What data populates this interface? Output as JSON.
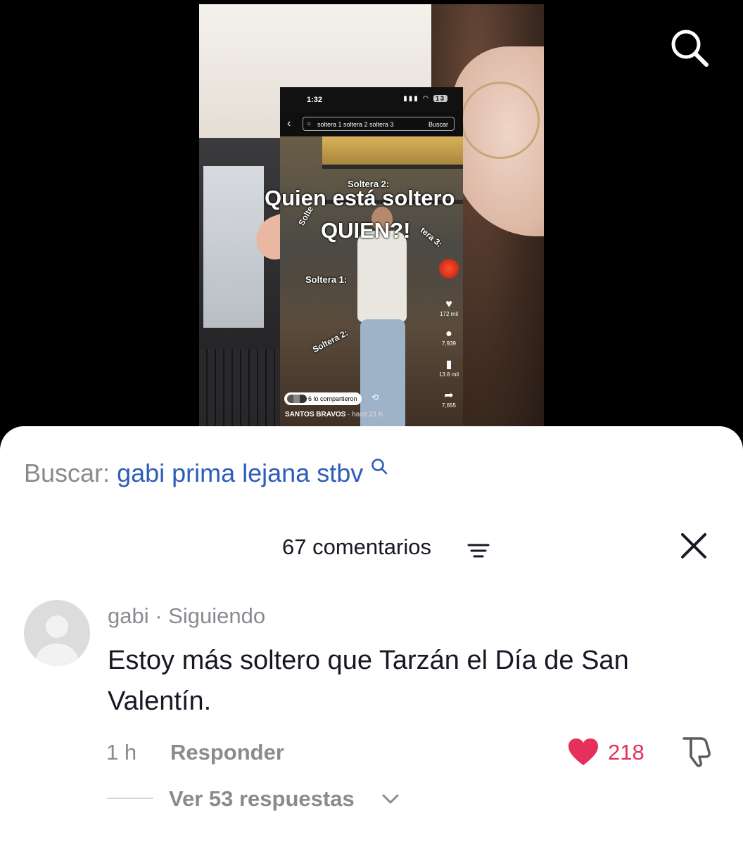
{
  "video": {
    "phone_time": "1:32",
    "battery": "13",
    "phone_search_query": "soltera 1 soltera 2 soltera 3",
    "phone_search_button": "Buscar",
    "overlay_title_line1": "Quien está soltero",
    "overlay_title_line2": "QUIEN?!",
    "overlay_soltera2_top": "Soltera 2:",
    "overlay_soltera1": "Soltera 1:",
    "overlay_soltera2_low": "Soltera 2:",
    "overlay_soltera3": "tera 3:",
    "overlay_solte": "Solte",
    "likes": "172 mil",
    "comments": "7,939",
    "saves": "13.8 mil",
    "shares": "7,655",
    "shared_by": "6 lo compartieron",
    "author": "SANTOS BRAVOS",
    "author_time": "· hace 21 h"
  },
  "sheet": {
    "search_label": "Buscar:",
    "search_query": "gabi prima lejana stbv",
    "comments_count": "67 comentarios"
  },
  "comment": {
    "username": "gabi",
    "relation": "· Siguiendo",
    "text": "Estoy más soltero que Tarzán el Día de San Valentín.",
    "time": "1 h",
    "reply_label": "Responder",
    "likes": "218",
    "view_replies": "Ver 53 respuestas"
  },
  "colors": {
    "accent_like": "#e4305a",
    "search_query": "#2d5db8",
    "muted_text": "#8a8b91"
  },
  "icons": {
    "top_search": "search-icon",
    "sort": "sort-icon",
    "close": "close-icon",
    "like": "heart-icon",
    "dislike": "thumbs-down-icon",
    "chevron": "chevron-down-icon"
  }
}
